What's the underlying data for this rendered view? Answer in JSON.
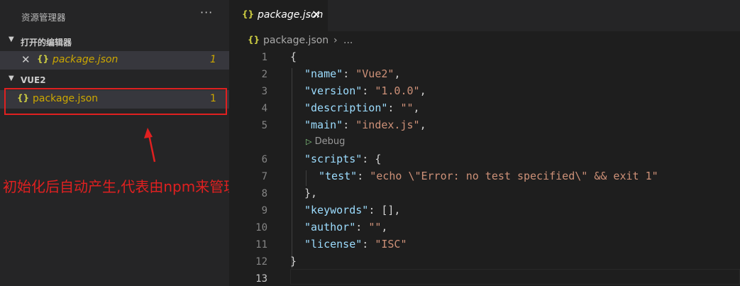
{
  "sidebar": {
    "title": "资源管理器",
    "more_label": "···",
    "open_editors": {
      "label": "打开的编辑器",
      "items": [
        {
          "name": "package.json",
          "badge": "1"
        }
      ]
    },
    "workspace": {
      "label": "VUE2",
      "items": [
        {
          "name": "package.json",
          "badge": "1"
        }
      ]
    }
  },
  "annotation": {
    "text": "初始化后自动产生,代表由npm来管理",
    "color": "#e02020"
  },
  "editor": {
    "tab": {
      "name": "package.json",
      "close_label": "×"
    },
    "breadcrumb": {
      "file": "package.json",
      "separator": "›",
      "more": "..."
    },
    "codelens": {
      "label": "Debug"
    },
    "line_numbers": [
      "1",
      "2",
      "3",
      "4",
      "5",
      "6",
      "7",
      "8",
      "9",
      "10",
      "11",
      "12",
      "13"
    ],
    "lines": [
      {
        "tokens": [
          {
            "t": "{",
            "c": "p"
          }
        ]
      },
      {
        "tokens": [
          {
            "t": "\"name\"",
            "c": "k"
          },
          {
            "t": ": ",
            "c": "p"
          },
          {
            "t": "\"Vue2\"",
            "c": "s"
          },
          {
            "t": ",",
            "c": "p"
          }
        ]
      },
      {
        "tokens": [
          {
            "t": "\"version\"",
            "c": "k"
          },
          {
            "t": ": ",
            "c": "p"
          },
          {
            "t": "\"1.0.0\"",
            "c": "s"
          },
          {
            "t": ",",
            "c": "p"
          }
        ]
      },
      {
        "tokens": [
          {
            "t": "\"description\"",
            "c": "k"
          },
          {
            "t": ": ",
            "c": "p"
          },
          {
            "t": "\"\"",
            "c": "s"
          },
          {
            "t": ",",
            "c": "p"
          }
        ]
      },
      {
        "tokens": [
          {
            "t": "\"main\"",
            "c": "k"
          },
          {
            "t": ": ",
            "c": "p"
          },
          {
            "t": "\"index.js\"",
            "c": "s"
          },
          {
            "t": ",",
            "c": "p"
          }
        ]
      },
      {
        "tokens": [
          {
            "t": "\"scripts\"",
            "c": "k"
          },
          {
            "t": ": {",
            "c": "p"
          }
        ]
      },
      {
        "tokens": [
          {
            "t": "\"test\"",
            "c": "k"
          },
          {
            "t": ": ",
            "c": "p"
          },
          {
            "t": "\"echo \\\"Error: no test specified\\\" && exit 1\"",
            "c": "s"
          }
        ]
      },
      {
        "tokens": [
          {
            "t": "},",
            "c": "p"
          }
        ]
      },
      {
        "tokens": [
          {
            "t": "\"keywords\"",
            "c": "k"
          },
          {
            "t": ": [],",
            "c": "p"
          }
        ]
      },
      {
        "tokens": [
          {
            "t": "\"author\"",
            "c": "k"
          },
          {
            "t": ": ",
            "c": "p"
          },
          {
            "t": "\"\"",
            "c": "s"
          },
          {
            "t": ",",
            "c": "p"
          }
        ]
      },
      {
        "tokens": [
          {
            "t": "\"license\"",
            "c": "k"
          },
          {
            "t": ": ",
            "c": "p"
          },
          {
            "t": "\"ISC\"",
            "c": "s"
          }
        ]
      },
      {
        "tokens": [
          {
            "t": "}",
            "c": "p"
          }
        ]
      },
      {
        "tokens": []
      }
    ]
  },
  "colors": {
    "modified": "#cca700",
    "json_icon": "#cbcb41",
    "key": "#9cdcfe",
    "string": "#ce9178"
  }
}
